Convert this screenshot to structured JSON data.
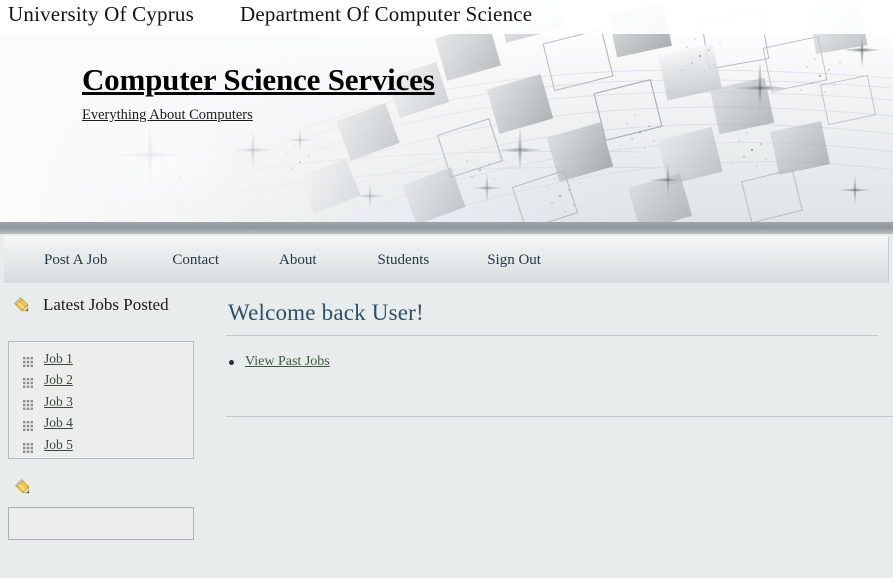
{
  "banner": {
    "university": "University Of Cyprus",
    "department": "Department Of Computer Science",
    "site_title": "Computer Science Services",
    "tagline": "Everything About Computers",
    "art_description": "abstract-grayscale-squares-sparkles"
  },
  "nav": {
    "items": [
      {
        "label": "Post A Job"
      },
      {
        "label": "Contact"
      },
      {
        "label": "About"
      },
      {
        "label": "Students"
      },
      {
        "label": "Sign Out"
      }
    ]
  },
  "sidebar": {
    "heading": "Latest Jobs Posted",
    "heading_icon": "pencil-icon",
    "job_icon": "grid-icon",
    "jobs": [
      {
        "label": "Job 1"
      },
      {
        "label": "Job 2"
      },
      {
        "label": "Job 3"
      },
      {
        "label": "Job 4"
      },
      {
        "label": "Job 5"
      }
    ],
    "secondary_icon": "pencil-icon",
    "input": {
      "value": "",
      "placeholder": ""
    }
  },
  "main": {
    "title": "Welcome back User!",
    "links": [
      {
        "label": "View Past Jobs"
      }
    ]
  },
  "colors": {
    "page_background": "#e9ecec",
    "heading_blue": "#2f5068",
    "nav_text": "#253746",
    "link_green": "#3d5a3d",
    "band_gray": "#8e969c",
    "pencil_yellow": "#f0b429"
  }
}
